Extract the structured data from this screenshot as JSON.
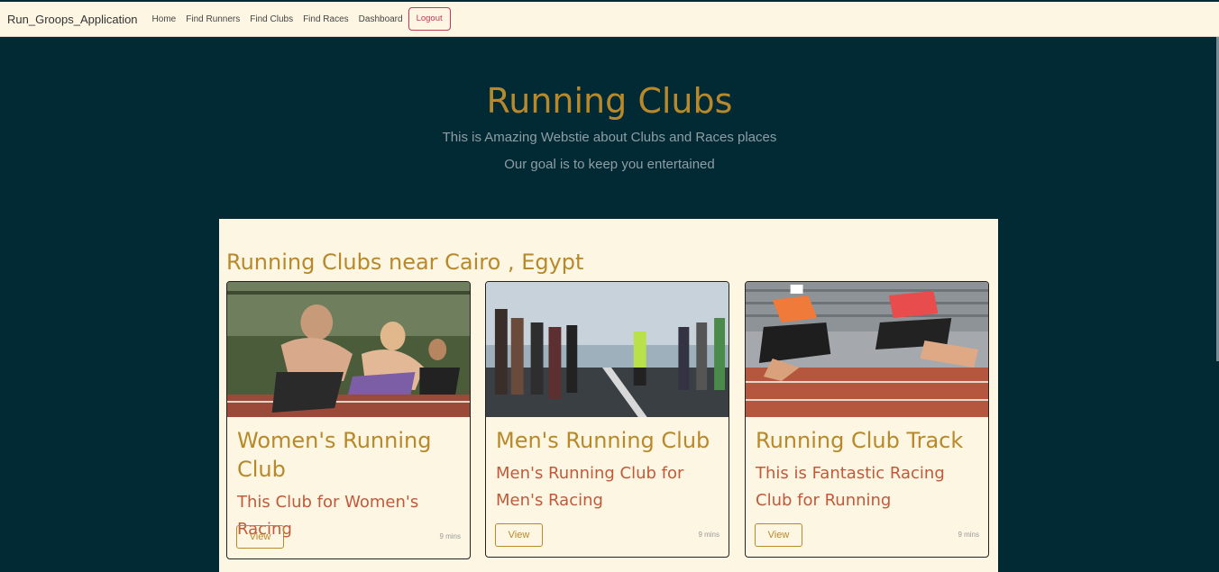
{
  "navbar": {
    "brand": "Run_Groops_Application",
    "links": [
      "Home",
      "Find Runners",
      "Find Clubs",
      "Find Races",
      "Dashboard"
    ],
    "logout_label": "Logout"
  },
  "hero": {
    "title": "Running Clubs",
    "line1": "This is Amazing Webstie about Clubs and Races places",
    "line2": "Our goal is to keep you entertained"
  },
  "section": {
    "title": "Running Clubs near Cairo , Egypt"
  },
  "cards": [
    {
      "title": "Women's Running Club",
      "text": "This Club for Women's Racing",
      "button": "View",
      "time": "9 mins"
    },
    {
      "title": "Men's Running Club",
      "text": "Men's Running Club for Men's Racing",
      "button": "View",
      "time": "9 mins"
    },
    {
      "title": "Running Club Track",
      "text": "This is Fantastic Racing Club for Running",
      "button": "View",
      "time": "9 mins"
    }
  ],
  "colors": {
    "background": "#022a35",
    "panel": "#fdf6e3",
    "accent_gold": "#b8892a",
    "accent_red": "#c05a3a",
    "logout": "#c0395a"
  }
}
